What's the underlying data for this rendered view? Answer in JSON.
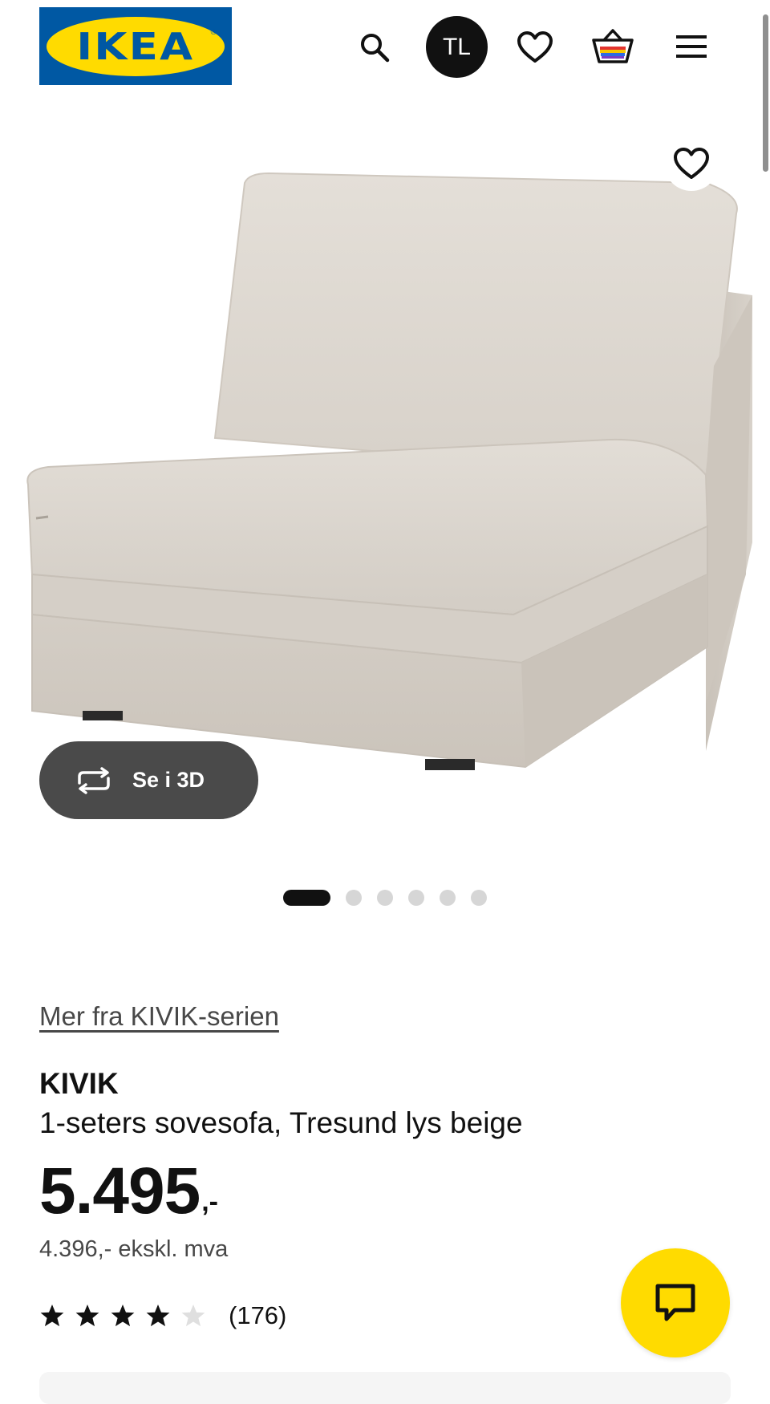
{
  "header": {
    "logo_text": "IKEA",
    "logo_reg": "®",
    "avatar_initials": "TL",
    "icons": [
      "search-icon",
      "user-avatar",
      "heart-icon",
      "basket-icon",
      "menu-icon"
    ],
    "colors": {
      "brand_blue": "#0058a3",
      "brand_yellow": "#ffdb00"
    }
  },
  "gallery": {
    "view_3d_label": "Se i 3D",
    "image_count": 6,
    "active_index": 0
  },
  "product": {
    "series_link": "Mer fra KIVIK-serien",
    "name": "KIVIK",
    "description": "1-seters sovesofa, Tresund lys beige",
    "price_main": "5.495",
    "price_suffix": ",-",
    "price_ex_vat": "4.396,- ekskl. mva",
    "rating": {
      "value": 4,
      "max": 5,
      "count_text": "(176)"
    }
  },
  "chat": {
    "icon": "chat-icon",
    "color": "#ffdb00"
  }
}
